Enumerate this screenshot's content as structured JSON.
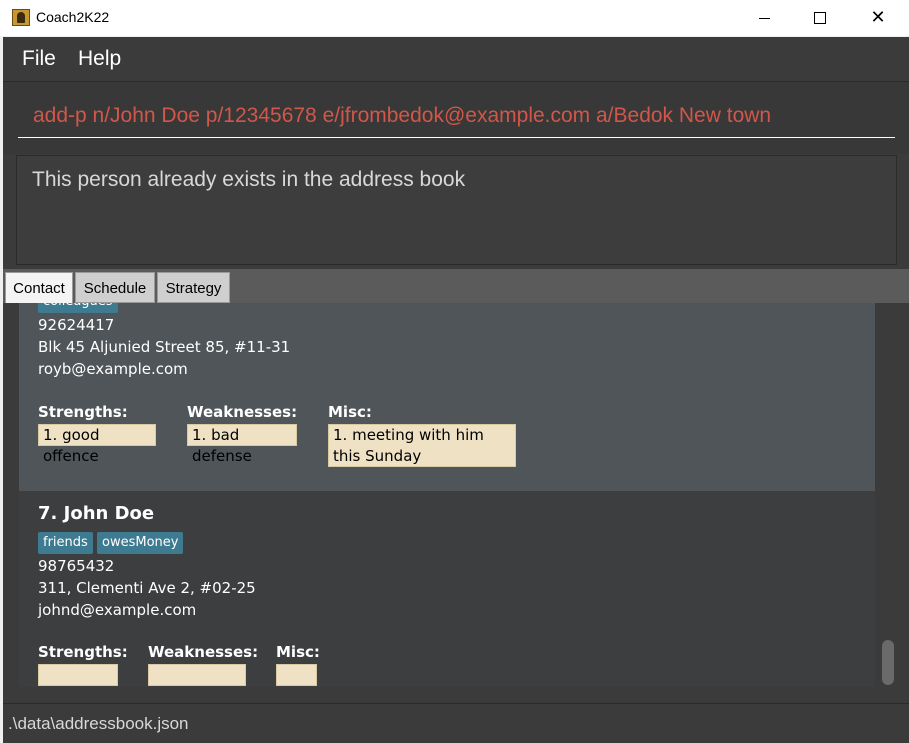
{
  "window": {
    "title": "Coach2K22"
  },
  "menubar": {
    "items": [
      "File",
      "Help"
    ]
  },
  "command": {
    "value": "add-p n/John Doe p/12345678 e/jfrombedok@example.com a/Bedok New town",
    "text_color": "#d0574a"
  },
  "result": {
    "message": "This person already exists in the address book"
  },
  "tabs": [
    "Contact",
    "Schedule",
    "Strategy"
  ],
  "active_tab": "Contact",
  "persons": [
    {
      "tags": [
        "colleagues"
      ],
      "phone": "92624417",
      "address": "Blk 45 Aljunied Street 85, #11-31",
      "email": "royb@example.com",
      "strengths_label": "Strengths:",
      "weaknesses_label": "Weaknesses:",
      "misc_label": "Misc:",
      "strengths": "1. good offence",
      "weaknesses": "1. bad defense",
      "misc": "1. meeting with him this Sunday"
    },
    {
      "index_name": "7.  John Doe",
      "tags": [
        "friends",
        "owesMoney"
      ],
      "phone": "98765432",
      "address": "311, Clementi Ave 2, #02-25",
      "email": "johnd@example.com",
      "strengths_label": "Strengths:",
      "weaknesses_label": "Weaknesses:",
      "misc_label": "Misc:",
      "strengths": "",
      "weaknesses": "",
      "misc": ""
    }
  ],
  "status": {
    "path": ".\\data\\addressbook.json"
  },
  "colors": {
    "background": "#3b3b3b",
    "tag": "#3e7b91",
    "chip": "#efe2c4",
    "selected_card": "#4f5558"
  },
  "icons": {
    "app": "coach-app-icon",
    "minimize": "minimize-icon",
    "maximize": "maximize-icon",
    "close": "close-icon"
  }
}
